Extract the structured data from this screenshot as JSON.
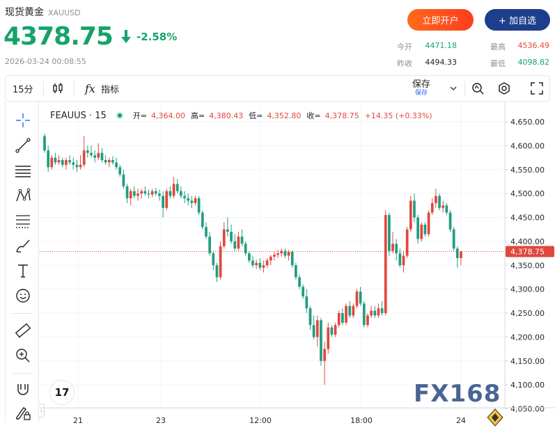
{
  "header": {
    "title": "现货黄金",
    "symbol": "XAUUSD",
    "price": "4378.75",
    "change_pct": "-2.58%",
    "timestamp": "2026-03-24 00:08:55",
    "open_account_label": "立即开户",
    "add_watch_label": "+ 加自选",
    "stats": {
      "open_label": "今开",
      "open_value": "4471.18",
      "high_label": "最高",
      "high_value": "4536.49",
      "prev_close_label": "昨收",
      "prev_close_value": "4494.33",
      "low_label": "最低",
      "low_value": "4098.82"
    }
  },
  "toolbar": {
    "interval": "15分",
    "indicator_label": "指标",
    "save_label": "保存",
    "save_sub": "保存"
  },
  "legend": {
    "symbol": "FEAUUS · 15",
    "open_key": "开=",
    "open": "4,364.00",
    "high_key": "高=",
    "high": "4,380.43",
    "low_key": "低=",
    "low": "4,352.80",
    "close_key": "收=",
    "close": "4,378.75",
    "change": "+14.35 (+0.33%)"
  },
  "watermark": "FX168",
  "tv_logo": "17",
  "colors": {
    "up": "#e0483e",
    "down": "#1f9e80",
    "price_tag": "#e0483e",
    "accent_green": "#16a36a",
    "brand_blue": "#1d3e8c"
  },
  "chart_data": {
    "type": "candlestick",
    "y_ticks": [
      4650,
      4600,
      4550,
      4500,
      4450,
      4400,
      4350,
      4300,
      4250,
      4200,
      4150,
      4100,
      4050
    ],
    "y_tick_labels": [
      "4,650.00",
      "4,600.00",
      "4,550.00",
      "4,500.00",
      "4,450.00",
      "4,400.00",
      "4,350.00",
      "4,300.00",
      "4,250.00",
      "4,200.00",
      "4,150.00",
      "4,100.00",
      "4,050.00"
    ],
    "ylim": [
      4040,
      4680
    ],
    "x_tick_labels": [
      "21",
      "23",
      "12:00",
      "18:00",
      "24"
    ],
    "last_price": 4378.75,
    "last_price_label": "4,378.75",
    "grid": true,
    "candles": [
      [
        4620,
        4625,
        4585,
        4590
      ],
      [
        4590,
        4600,
        4545,
        4555
      ],
      [
        4555,
        4580,
        4550,
        4575
      ],
      [
        4575,
        4585,
        4560,
        4565
      ],
      [
        4565,
        4580,
        4560,
        4570
      ],
      [
        4570,
        4575,
        4555,
        4560
      ],
      [
        4560,
        4575,
        4550,
        4570
      ],
      [
        4570,
        4580,
        4560,
        4565
      ],
      [
        4565,
        4575,
        4550,
        4560
      ],
      [
        4560,
        4570,
        4545,
        4555
      ],
      [
        4555,
        4580,
        4550,
        4560
      ],
      [
        4560,
        4620,
        4555,
        4590
      ],
      [
        4590,
        4600,
        4575,
        4585
      ],
      [
        4585,
        4600,
        4575,
        4580
      ],
      [
        4580,
        4590,
        4565,
        4575
      ],
      [
        4575,
        4605,
        4570,
        4585
      ],
      [
        4585,
        4595,
        4565,
        4570
      ],
      [
        4570,
        4580,
        4560,
        4565
      ],
      [
        4565,
        4575,
        4555,
        4570
      ],
      [
        4570,
        4578,
        4560,
        4565
      ],
      [
        4565,
        4575,
        4550,
        4555
      ],
      [
        4555,
        4560,
        4535,
        4540
      ],
      [
        4540,
        4550,
        4510,
        4515
      ],
      [
        4515,
        4520,
        4480,
        4490
      ],
      [
        4490,
        4510,
        4475,
        4505
      ],
      [
        4505,
        4515,
        4490,
        4495
      ],
      [
        4495,
        4510,
        4485,
        4500
      ],
      [
        4500,
        4510,
        4490,
        4505
      ],
      [
        4505,
        4515,
        4495,
        4500
      ],
      [
        4500,
        4508,
        4490,
        4498
      ],
      [
        4498,
        4510,
        4492,
        4505
      ],
      [
        4505,
        4512,
        4495,
        4500
      ],
      [
        4500,
        4508,
        4485,
        4495
      ],
      [
        4495,
        4505,
        4450,
        4470
      ],
      [
        4470,
        4510,
        4465,
        4505
      ],
      [
        4505,
        4515,
        4490,
        4495
      ],
      [
        4495,
        4535,
        4490,
        4520
      ],
      [
        4520,
        4530,
        4500,
        4505
      ],
      [
        4505,
        4515,
        4490,
        4495
      ],
      [
        4495,
        4505,
        4480,
        4490
      ],
      [
        4490,
        4500,
        4475,
        4485
      ],
      [
        4485,
        4495,
        4470,
        4480
      ],
      [
        4480,
        4495,
        4475,
        4490
      ],
      [
        4490,
        4495,
        4455,
        4460
      ],
      [
        4460,
        4465,
        4425,
        4430
      ],
      [
        4430,
        4440,
        4405,
        4410
      ],
      [
        4410,
        4420,
        4370,
        4375
      ],
      [
        4375,
        4380,
        4340,
        4350
      ],
      [
        4350,
        4355,
        4315,
        4325
      ],
      [
        4325,
        4400,
        4320,
        4390
      ],
      [
        4390,
        4440,
        4385,
        4425
      ],
      [
        4425,
        4450,
        4410,
        4420
      ],
      [
        4420,
        4435,
        4395,
        4400
      ],
      [
        4400,
        4415,
        4380,
        4385
      ],
      [
        4385,
        4420,
        4380,
        4410
      ],
      [
        4410,
        4425,
        4390,
        4395
      ],
      [
        4395,
        4400,
        4370,
        4375
      ],
      [
        4375,
        4380,
        4355,
        4360
      ],
      [
        4360,
        4370,
        4345,
        4350
      ],
      [
        4350,
        4362,
        4342,
        4355
      ],
      [
        4355,
        4365,
        4340,
        4345
      ],
      [
        4345,
        4360,
        4335,
        4350
      ],
      [
        4350,
        4365,
        4345,
        4360
      ],
      [
        4360,
        4372,
        4350,
        4368
      ],
      [
        4368,
        4378,
        4360,
        4372
      ],
      [
        4372,
        4382,
        4365,
        4375
      ],
      [
        4375,
        4385,
        4368,
        4380
      ],
      [
        4380,
        4385,
        4365,
        4370
      ],
      [
        4370,
        4382,
        4360,
        4378
      ],
      [
        4378,
        4380,
        4345,
        4350
      ],
      [
        4350,
        4355,
        4320,
        4325
      ],
      [
        4325,
        4330,
        4300,
        4305
      ],
      [
        4305,
        4310,
        4280,
        4285
      ],
      [
        4285,
        4300,
        4250,
        4260
      ],
      [
        4260,
        4265,
        4215,
        4225
      ],
      [
        4225,
        4245,
        4195,
        4200
      ],
      [
        4200,
        4245,
        4180,
        4235
      ],
      [
        4235,
        4240,
        4140,
        4150
      ],
      [
        4150,
        4190,
        4100,
        4175
      ],
      [
        4175,
        4230,
        4165,
        4220
      ],
      [
        4220,
        4225,
        4200,
        4205
      ],
      [
        4205,
        4230,
        4200,
        4225
      ],
      [
        4225,
        4255,
        4220,
        4250
      ],
      [
        4250,
        4260,
        4225,
        4230
      ],
      [
        4230,
        4270,
        4225,
        4265
      ],
      [
        4265,
        4275,
        4240,
        4245
      ],
      [
        4245,
        4270,
        4240,
        4265
      ],
      [
        4265,
        4300,
        4260,
        4295
      ],
      [
        4295,
        4305,
        4265,
        4270
      ],
      [
        4270,
        4275,
        4220,
        4225
      ],
      [
        4225,
        4250,
        4220,
        4245
      ],
      [
        4245,
        4265,
        4240,
        4255
      ],
      [
        4255,
        4265,
        4240,
        4245
      ],
      [
        4245,
        4270,
        4240,
        4260
      ],
      [
        4260,
        4275,
        4245,
        4250
      ],
      [
        4250,
        4465,
        4245,
        4455
      ],
      [
        4455,
        4460,
        4370,
        4380
      ],
      [
        4380,
        4420,
        4375,
        4395
      ],
      [
        4395,
        4405,
        4360,
        4375
      ],
      [
        4375,
        4385,
        4345,
        4350
      ],
      [
        4350,
        4380,
        4335,
        4370
      ],
      [
        4370,
        4430,
        4365,
        4425
      ],
      [
        4425,
        4495,
        4420,
        4485
      ],
      [
        4485,
        4500,
        4440,
        4450
      ],
      [
        4450,
        4455,
        4395,
        4405
      ],
      [
        4405,
        4440,
        4400,
        4435
      ],
      [
        4435,
        4440,
        4410,
        4415
      ],
      [
        4415,
        4465,
        4410,
        4460
      ],
      [
        4460,
        4490,
        4455,
        4480
      ],
      [
        4480,
        4510,
        4470,
        4495
      ],
      [
        4495,
        4500,
        4465,
        4470
      ],
      [
        4470,
        4485,
        4460,
        4475
      ],
      [
        4475,
        4480,
        4455,
        4460
      ],
      [
        4460,
        4465,
        4420,
        4425
      ],
      [
        4425,
        4430,
        4380,
        4385
      ],
      [
        4385,
        4390,
        4345,
        4365
      ],
      [
        4365,
        4380,
        4350,
        4378.75
      ]
    ]
  }
}
